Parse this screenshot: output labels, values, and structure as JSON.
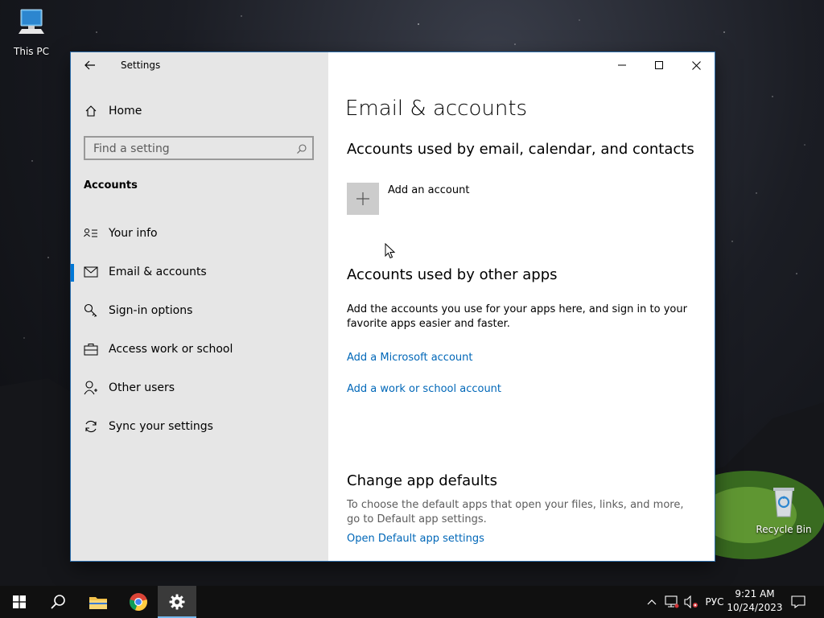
{
  "desktop": {
    "icons": [
      {
        "label": "This PC"
      },
      {
        "label": "Recycle Bin"
      }
    ]
  },
  "window": {
    "title": "Settings",
    "controls": {
      "minimize": "minimize-icon",
      "maximize": "maximize-icon",
      "close": "close-icon"
    }
  },
  "sidebar": {
    "home": "Home",
    "search_placeholder": "Find a setting",
    "section": "Accounts",
    "items": [
      {
        "label": "Your info",
        "icon": "contact-card-icon",
        "active": false
      },
      {
        "label": "Email & accounts",
        "icon": "mail-icon",
        "active": true
      },
      {
        "label": "Sign-in options",
        "icon": "key-icon",
        "active": false
      },
      {
        "label": "Access work or school",
        "icon": "briefcase-icon",
        "active": false
      },
      {
        "label": "Other users",
        "icon": "person-add-icon",
        "active": false
      },
      {
        "label": "Sync your settings",
        "icon": "sync-icon",
        "active": false
      }
    ]
  },
  "content": {
    "title": "Email & accounts",
    "section1": {
      "heading": "Accounts used by email, calendar, and contacts",
      "add_account": "Add an account"
    },
    "section2": {
      "heading": "Accounts used by other apps",
      "description": "Add the accounts you use for your apps here, and sign in to your favorite apps easier and faster.",
      "link_microsoft": "Add a Microsoft account",
      "link_work": "Add a work or school account"
    },
    "section3": {
      "heading": "Change app defaults",
      "description": "To choose the default apps that open your files, links, and more, go to Default app settings.",
      "link": "Open Default app settings"
    }
  },
  "taskbar": {
    "language": "РУС",
    "time": "9:21 AM",
    "date": "10/24/2023",
    "accent": "#76b9ed"
  },
  "colors": {
    "link": "#0067b8",
    "accent": "#0078d7",
    "sidebar_bg": "#e6e6e6"
  }
}
